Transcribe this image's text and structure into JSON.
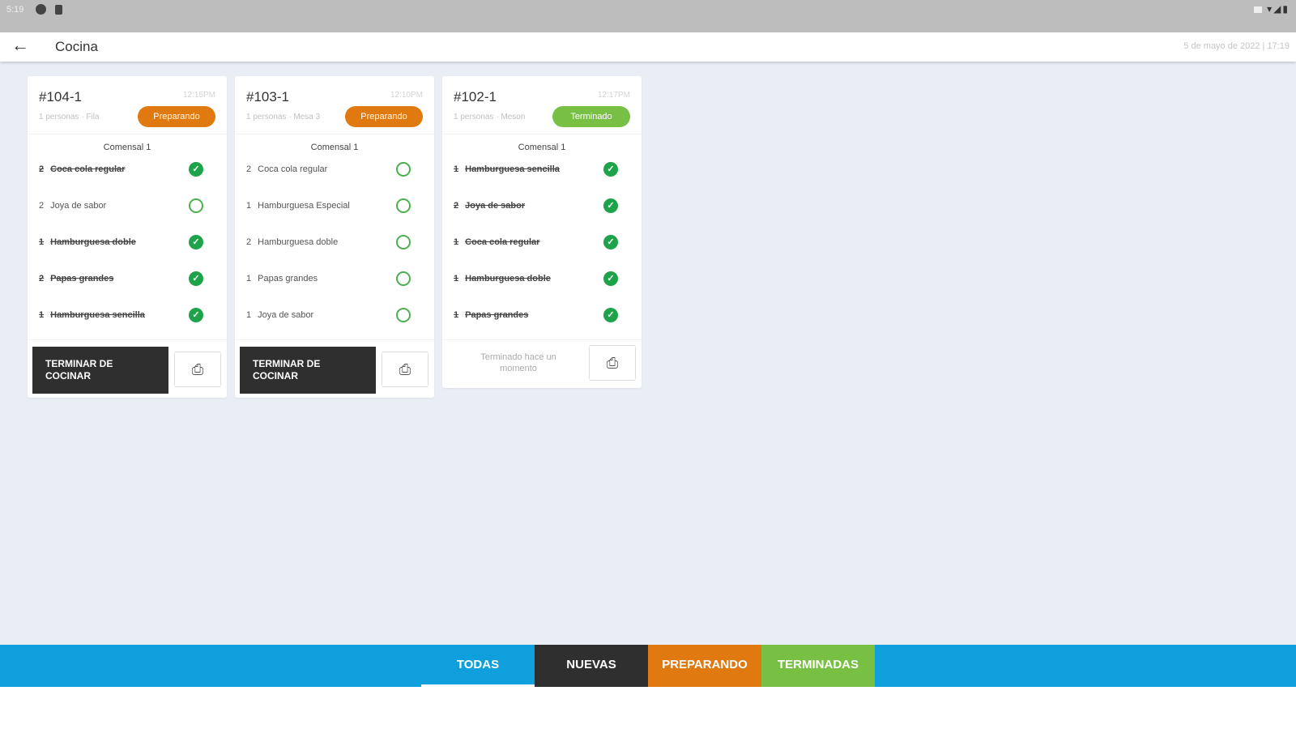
{
  "status_bar": {
    "time": "5:19"
  },
  "app_bar": {
    "back_icon": "arrow-left-icon",
    "title": "Cocina",
    "datetime": "5 de mayo de 2022 | 17:19"
  },
  "colors": {
    "preparando": "#e07a10",
    "terminado": "#77c043",
    "nuevas": "#2f2f2f",
    "todas": "#0e9fdc",
    "check": "#1fa34a"
  },
  "orders": [
    {
      "id": "#104-1",
      "time": "12:15PM",
      "subtitle": "1 personas · Fila",
      "status": "Preparando",
      "comensal": "Comensal 1",
      "items": [
        {
          "qty": "2",
          "name": "Coca cola regular",
          "done": true
        },
        {
          "qty": "2",
          "name": "Joya de sabor",
          "done": false
        },
        {
          "qty": "1",
          "name": "Hamburguesa doble",
          "done": true
        },
        {
          "qty": "2",
          "name": "Papas grandes",
          "done": true
        },
        {
          "qty": "1",
          "name": "Hamburguesa sencilla",
          "done": true
        }
      ],
      "finish_label_1": "TERMINAR DE",
      "finish_label_2": "COCINAR"
    },
    {
      "id": "#103-1",
      "time": "12:10PM",
      "subtitle": "1 personas · Mesa 3",
      "status": "Preparando",
      "comensal": "Comensal 1",
      "items": [
        {
          "qty": "2",
          "name": "Coca cola regular",
          "done": false
        },
        {
          "qty": "1",
          "name": "Hamburguesa Especial",
          "done": false
        },
        {
          "qty": "2",
          "name": "Hamburguesa doble",
          "done": false
        },
        {
          "qty": "1",
          "name": "Papas grandes",
          "done": false
        },
        {
          "qty": "1",
          "name": "Joya de sabor",
          "done": false
        }
      ],
      "finish_label_1": "TERMINAR DE",
      "finish_label_2": "COCINAR"
    },
    {
      "id": "#102-1",
      "time": "12:17PM",
      "subtitle": "1 personas · Meson",
      "status": "Terminado",
      "comensal": "Comensal 1",
      "items": [
        {
          "qty": "1",
          "name": "Hamburguesa sencilla",
          "done": true
        },
        {
          "qty": "2",
          "name": "Joya de sabor",
          "done": true
        },
        {
          "qty": "1",
          "name": "Coca cola regular",
          "done": true
        },
        {
          "qty": "1",
          "name": "Hamburguesa doble",
          "done": true
        },
        {
          "qty": "1",
          "name": "Papas grandes",
          "done": true
        }
      ],
      "done_text_1": "Terminado hace un",
      "done_text_2": "momento"
    }
  ],
  "tabs": [
    {
      "label": "TODAS",
      "active": true
    },
    {
      "label": "NUEVAS",
      "active": false
    },
    {
      "label": "PREPARANDO",
      "active": false
    },
    {
      "label": "TERMINADAS",
      "active": false
    }
  ]
}
